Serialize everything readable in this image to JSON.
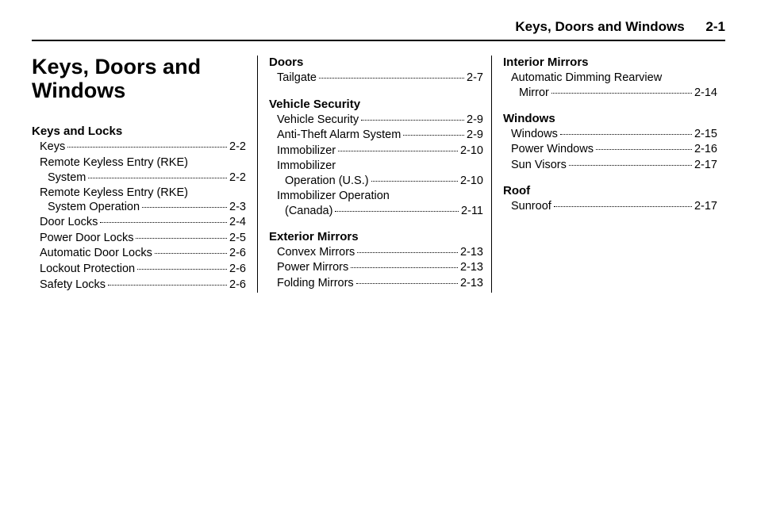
{
  "header": {
    "title": "Keys, Doors and Windows",
    "page": "2-1"
  },
  "chapter": {
    "title": "Keys, Doors and Windows"
  },
  "columns": [
    {
      "sections": [
        {
          "heading": "Keys and Locks",
          "entries": [
            {
              "label": "Keys",
              "page": "2-2"
            },
            {
              "label1": "Remote Keyless Entry (RKE)",
              "label2": "System",
              "page": "2-2",
              "multi": true
            },
            {
              "label1": "Remote Keyless Entry (RKE)",
              "label2": "System Operation",
              "page": "2-3",
              "multi": true
            },
            {
              "label": "Door Locks",
              "page": "2-4"
            },
            {
              "label": "Power Door Locks",
              "page": "2-5"
            },
            {
              "label": "Automatic Door Locks",
              "page": "2-6"
            },
            {
              "label": "Lockout Protection",
              "page": "2-6"
            },
            {
              "label": "Safety Locks",
              "page": "2-6"
            }
          ]
        }
      ]
    },
    {
      "sections": [
        {
          "heading": "Doors",
          "entries": [
            {
              "label": "Tailgate",
              "page": "2-7"
            }
          ]
        },
        {
          "heading": "Vehicle Security",
          "entries": [
            {
              "label": "Vehicle Security",
              "page": "2-9"
            },
            {
              "label": "Anti-Theft Alarm System",
              "page": "2-9"
            },
            {
              "label": "Immobilizer",
              "page": "2-10"
            },
            {
              "label1": "Immobilizer",
              "label2": "Operation (U.S.)",
              "page": "2-10",
              "multi": true
            },
            {
              "label1": "Immobilizer Operation",
              "label2": "(Canada)",
              "page": "2-11",
              "multi": true
            }
          ]
        },
        {
          "heading": "Exterior Mirrors",
          "entries": [
            {
              "label": "Convex Mirrors",
              "page": "2-13"
            },
            {
              "label": "Power Mirrors",
              "page": "2-13"
            },
            {
              "label": "Folding Mirrors",
              "page": "2-13"
            }
          ]
        }
      ]
    },
    {
      "sections": [
        {
          "heading": "Interior Mirrors",
          "entries": [
            {
              "label1": "Automatic Dimming Rearview",
              "label2": "Mirror",
              "page": "2-14",
              "multi": true
            }
          ]
        },
        {
          "heading": "Windows",
          "entries": [
            {
              "label": "Windows",
              "page": "2-15"
            },
            {
              "label": "Power Windows",
              "page": "2-16"
            },
            {
              "label": "Sun Visors",
              "page": "2-17"
            }
          ]
        },
        {
          "heading": "Roof",
          "entries": [
            {
              "label": "Sunroof",
              "page": "2-17"
            }
          ]
        }
      ]
    }
  ]
}
